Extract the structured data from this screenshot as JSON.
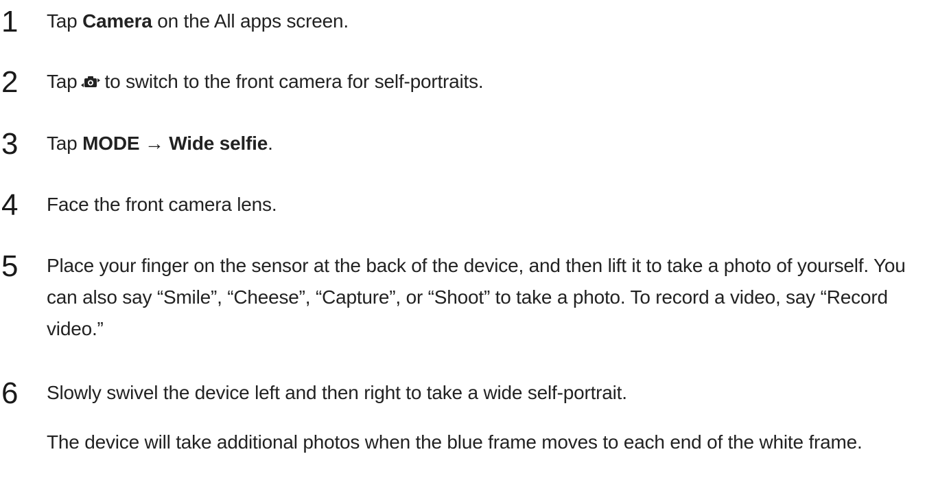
{
  "steps": [
    {
      "number": "1",
      "pre": "Tap ",
      "bold1": "Camera",
      "post": " on the All apps screen."
    },
    {
      "number": "2",
      "pre": "Tap",
      "icon": "switch-camera-icon",
      "post": "to switch to the front camera for self-portraits."
    },
    {
      "number": "3",
      "pre": "Tap ",
      "bold1": "MODE",
      "arrow": " → ",
      "bold2": "Wide selfie",
      "post": "."
    },
    {
      "number": "4",
      "text": "Face the front camera lens."
    },
    {
      "number": "5",
      "text": "Place your finger on the sensor at the back of the device, and then lift it to take a photo of yourself. You can also say “Smile”, “Cheese”, “Capture”, or “Shoot” to take a photo. To record a video, say “Record video.”"
    },
    {
      "number": "6",
      "text": "Slowly swivel the device left and then right to take a wide self-portrait.",
      "note": "The device will take additional photos when the blue frame moves to each end of the white frame."
    }
  ]
}
